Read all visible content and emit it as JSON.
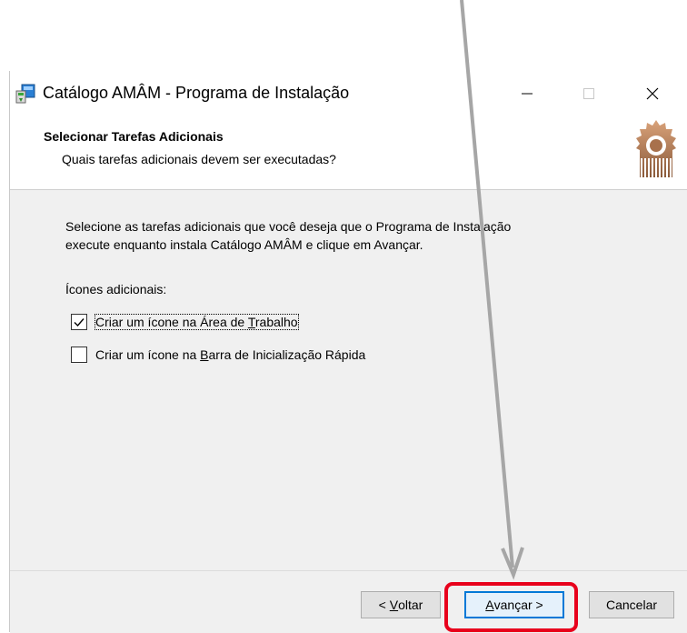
{
  "window": {
    "title": "Catálogo AMÂM - Programa de Instalação"
  },
  "header": {
    "title": "Selecionar Tarefas Adicionais",
    "subtitle": "Quais tarefas adicionais devem ser executadas?"
  },
  "content": {
    "description_line1": "Selecione as tarefas adicionais que você deseja que o Programa de Instalação",
    "description_line2": "execute enquanto instala Catálogo AMÂM e clique em Avançar.",
    "group_label": "Ícones adicionais:",
    "tasks": [
      {
        "label_pre": "Criar um ícone na Área de ",
        "label_accel": "T",
        "label_post": "rabalho",
        "checked": true
      },
      {
        "label_pre": "Criar um ícone na ",
        "label_accel": "B",
        "label_post": "arra de Inicialização Rápida",
        "checked": false
      }
    ]
  },
  "buttons": {
    "back_pre": "< ",
    "back_accel": "V",
    "back_post": "oltar",
    "next_accel": "A",
    "next_post": "vançar >",
    "cancel": "Cancelar"
  },
  "colors": {
    "highlight": "#e8001c",
    "arrow": "#a6a6a6",
    "focus": "#0078d7"
  }
}
